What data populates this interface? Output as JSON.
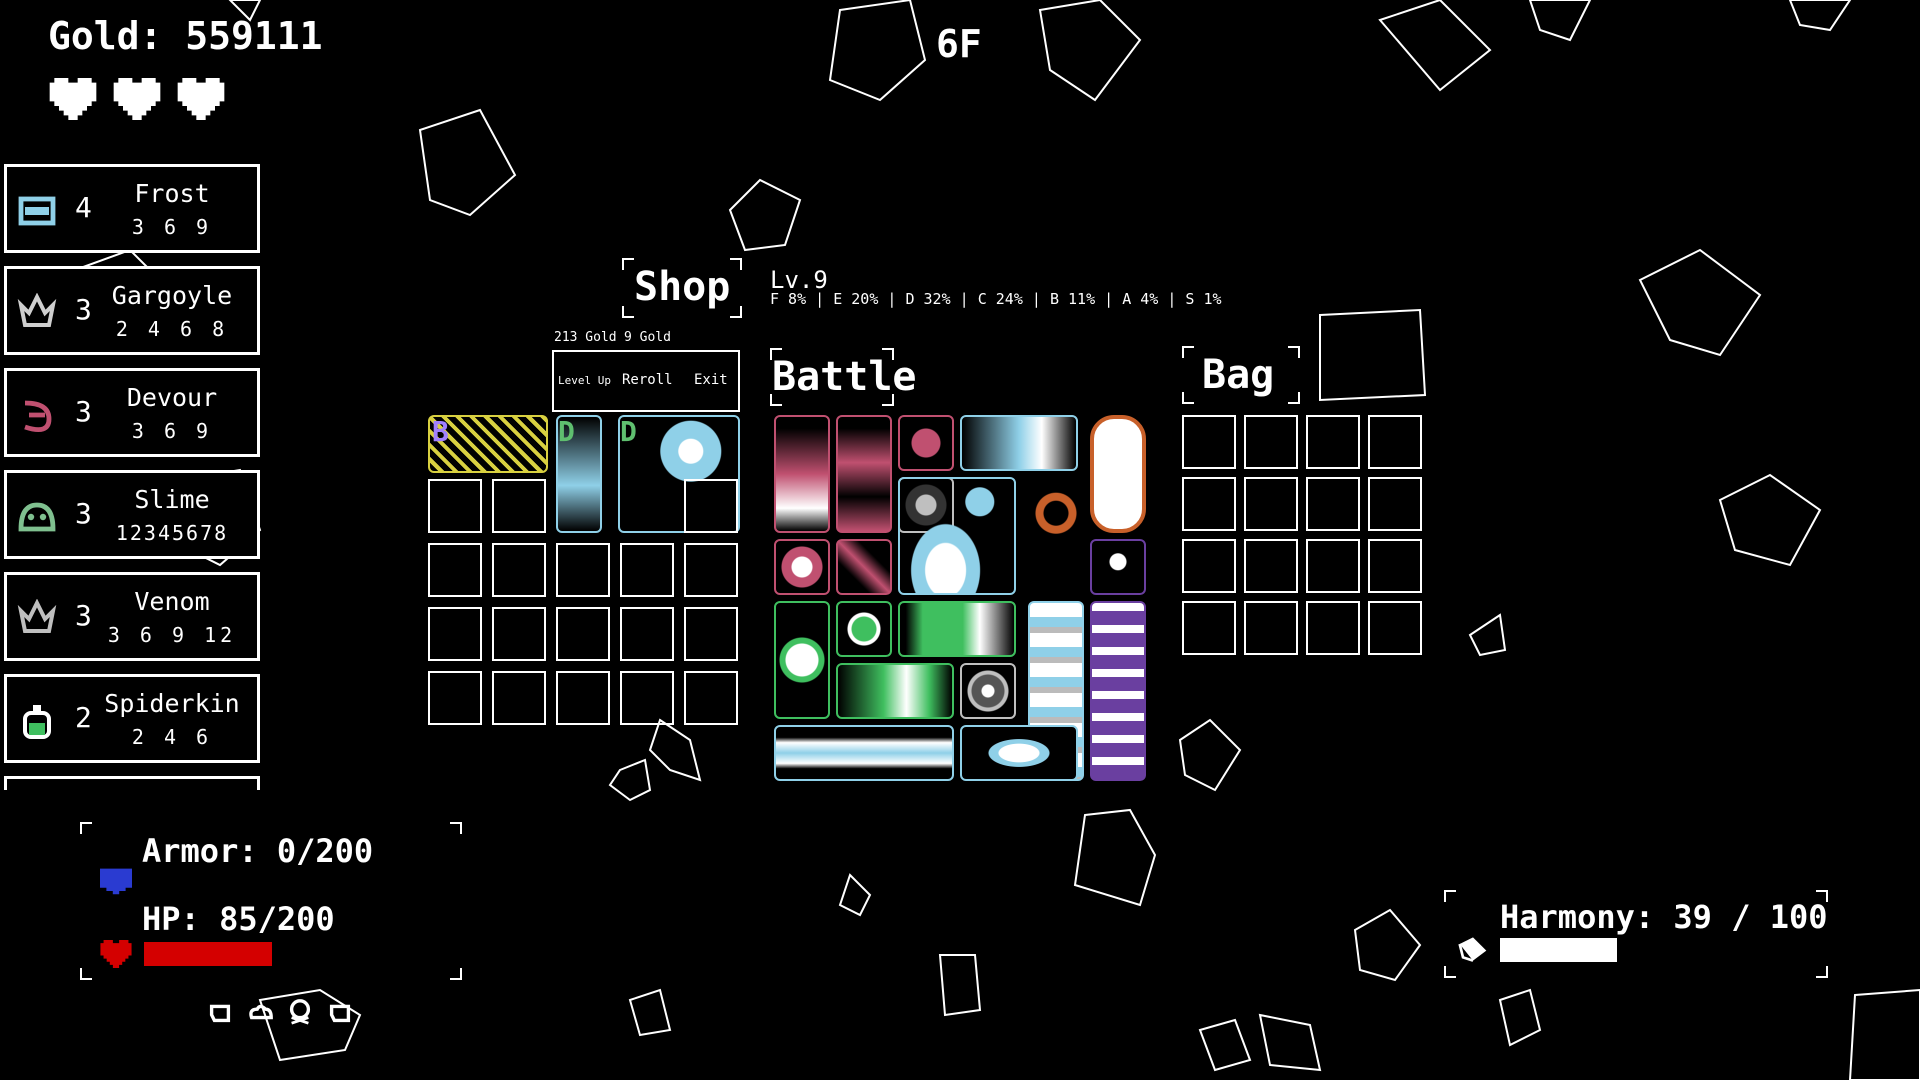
{
  "hud": {
    "gold_label": "Gold: 559111",
    "floor": "6F",
    "lives": 3
  },
  "synergies": [
    {
      "name": "Frost",
      "count": "4",
      "tiers": "3 6 9",
      "icon": "frost-icon",
      "color": "#8fd0e8"
    },
    {
      "name": "Gargoyle",
      "count": "3",
      "tiers": "2 4 6 8",
      "icon": "gargoyle-icon",
      "color": "#cfcfcf"
    },
    {
      "name": "Devour",
      "count": "3",
      "tiers": "3 6 9",
      "icon": "devour-icon",
      "color": "#c05070"
    },
    {
      "name": "Slime",
      "count": "3",
      "tiers": "12345678",
      "icon": "slime-icon",
      "color": "#7fc08f"
    },
    {
      "name": "Venom",
      "count": "3",
      "tiers": "3 6 9 12",
      "icon": "venom-icon",
      "color": "#bfbfbf"
    },
    {
      "name": "Spiderkin",
      "count": "2",
      "tiers": "2 4 6",
      "icon": "spiderkin-icon",
      "color": "#3fbf5f"
    }
  ],
  "shop": {
    "title": "Shop",
    "level": "Lv.9",
    "odds": "F 8% | E 20% | D 32% | C 24% | B 11% | A 4% | S 1%",
    "level_up_cost": "213 Gold",
    "reroll_cost": "9 Gold",
    "level_up_label": "Level Up",
    "reroll_label": "Reroll",
    "exit_label": "Exit",
    "rarities": [
      "B",
      "D",
      "D"
    ]
  },
  "battle": {
    "title": "Battle"
  },
  "bag": {
    "title": "Bag"
  },
  "stats": {
    "armor_label": "Armor: 0/200",
    "hp_label": "HP: 85/200",
    "armor_fraction": 0.0,
    "hp_fraction": 0.425,
    "armor_color": "#2a3bd1",
    "hp_color": "#d40000"
  },
  "harmony": {
    "label": "Harmony: 39 / 100",
    "fraction": 0.39
  },
  "colors": {
    "frost": "#8fd0e8",
    "devour": "#c05070",
    "slime": "#3fbf5f",
    "venom_purple": "#6a3fa0",
    "orange": "#c8602a",
    "gold_item": "#d8d040"
  }
}
